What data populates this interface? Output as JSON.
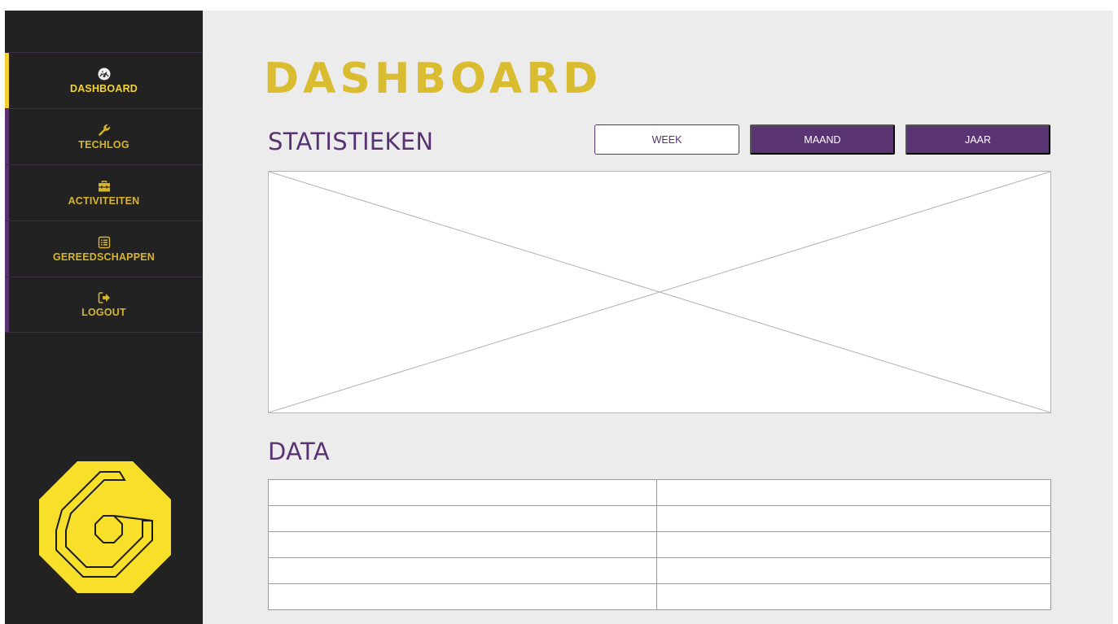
{
  "sidebar": {
    "items": [
      {
        "label": "DASHBOARD",
        "icon": "dashboard-gauge-icon",
        "active": true
      },
      {
        "label": "TECHLOG",
        "icon": "wrench-icon",
        "active": false
      },
      {
        "label": "ACTIVITEITEN",
        "icon": "toolbox-icon",
        "active": false
      },
      {
        "label": "GEREEDSCHAPPEN",
        "icon": "list-alt-icon",
        "active": false
      },
      {
        "label": "LOGOUT",
        "icon": "sign-out-icon",
        "active": false
      }
    ],
    "logo_icon": "octagon-logo-icon"
  },
  "main": {
    "title": "DASHBOARD",
    "statistics": {
      "title": "STATISTIEKEN",
      "buttons": [
        {
          "label": "WEEK",
          "selected": true
        },
        {
          "label": "MAAND",
          "selected": false
        },
        {
          "label": "JAAR",
          "selected": false
        }
      ]
    },
    "data": {
      "title": "DATA",
      "table": {
        "rows": 5,
        "columns": 2
      }
    }
  },
  "colors": {
    "accent_yellow": "#f0cf2f",
    "title_yellow": "#d9bc2f",
    "purple": "#5a3472",
    "sidebar_bg": "#222222",
    "content_bg": "#ececec"
  }
}
